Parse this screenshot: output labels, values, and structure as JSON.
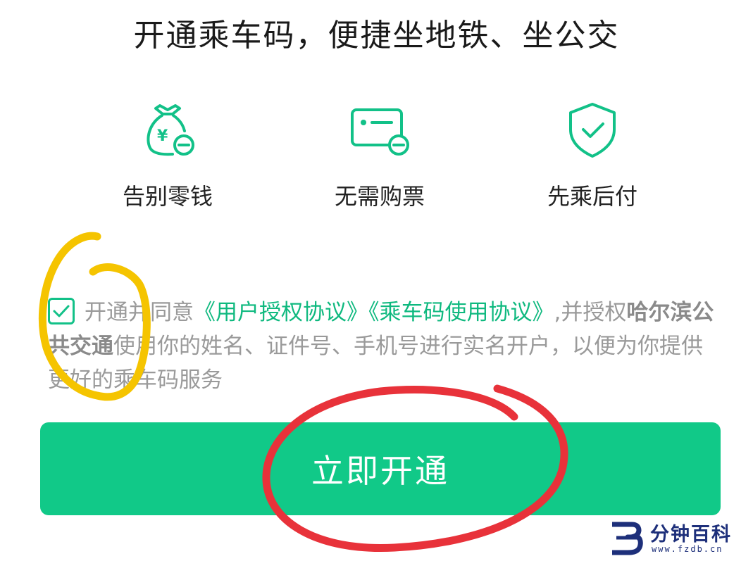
{
  "header": {
    "title": "开通乘车码，便捷坐地铁、坐公交"
  },
  "features": [
    {
      "icon": "money-bag-minus-icon",
      "label": "告别零钱",
      "currency_symbol": "¥"
    },
    {
      "icon": "card-minus-icon",
      "label": "无需购票"
    },
    {
      "icon": "shield-check-icon",
      "label": "先乘后付"
    }
  ],
  "agreement": {
    "checked": true,
    "prefix": "开通并同意",
    "link_user_auth": "《用户授权协议》",
    "link_ride_code": "《乘车码使用协议》",
    "middle": ",并授权",
    "company": "哈尔滨公共交通",
    "suffix": "使用你的姓名、证件号、手机号进行实名开户，以便为你提供更好的乘车码服务"
  },
  "cta": {
    "label": "立即开通"
  },
  "watermark": {
    "text": "分钟百科",
    "url": "www.fzdb.cn"
  },
  "colors": {
    "accent_green": "#11c988",
    "link_green": "#0fb97f",
    "annotation_yellow": "#f5c400",
    "annotation_red": "#e8323a",
    "watermark_blue": "#1d2f7a"
  }
}
